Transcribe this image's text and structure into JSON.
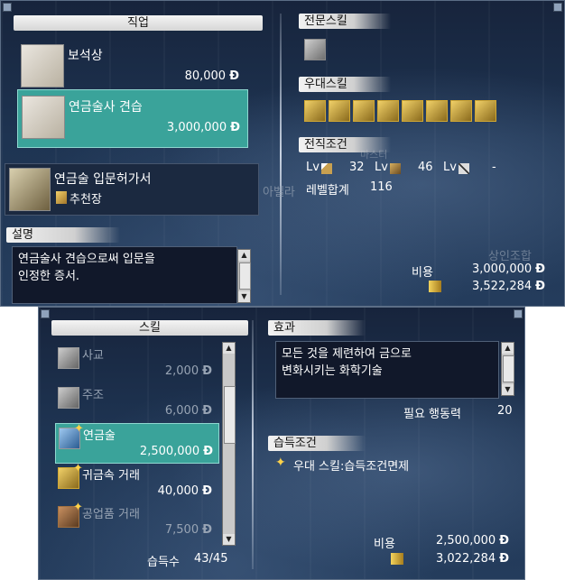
{
  "currency": "Đ",
  "top": {
    "job_header": "직업",
    "jobs": [
      {
        "name": "보석상",
        "price": "80,000",
        "selected": false
      },
      {
        "name": "연금술사 견습",
        "price": "3,000,000",
        "selected": true
      }
    ],
    "cert": {
      "title": "연금술 입문허가서",
      "subtitle": "추천장"
    },
    "desc_header": "설명",
    "desc_lines": [
      "연금술사 견습으로써 입문을",
      "인정한 증서."
    ],
    "special_skill_header": "전문스킬",
    "trade_skill_header": "우대스킬",
    "trade_skill_icons": [
      "trade-icon-1",
      "trade-icon-2",
      "trade-icon-3",
      "trade-icon-4",
      "trade-icon-5",
      "trade-icon-6",
      "trade-icon-7",
      "trade-icon-8"
    ],
    "req_header": "전직조건",
    "req": {
      "lv_label": "Lv",
      "lv1": "32",
      "lv2": "46",
      "lv3": "-",
      "sum_label": "레벨합계",
      "sum_value": "116"
    },
    "bg_texts": [
      "마스터",
      "아벨라",
      "상인조합"
    ],
    "cost_label": "비용",
    "cost_value": "3,000,000",
    "money_value": "3,522,284"
  },
  "bottom": {
    "skill_header": "스킬",
    "skills": [
      {
        "name": "사교",
        "price": "2,000",
        "selected": false,
        "dim": true,
        "star": false
      },
      {
        "name": "주조",
        "price": "6,000",
        "selected": false,
        "dim": true,
        "star": false
      },
      {
        "name": "연금술",
        "price": "2,500,000",
        "selected": true,
        "dim": false,
        "star": true
      },
      {
        "name": "귀금속 거래",
        "price": "40,000",
        "selected": false,
        "dim": false,
        "star": true
      },
      {
        "name": "공업품 거래",
        "price": "7,500",
        "selected": false,
        "dim": true,
        "star": true
      }
    ],
    "learned_label": "습득수",
    "learned_value": "43/45",
    "effect_header": "효과",
    "effect_lines": [
      "모든 것을 제련하여 금으로",
      "변화시키는 화학기술"
    ],
    "action_label": "필요 행동력",
    "action_value": "20",
    "cond_header": "습득조건",
    "cond_text": "우대 스킬:습득조건면제",
    "cost_label": "비용",
    "cost_value": "2,500,000",
    "money_value": "3,022,284"
  }
}
